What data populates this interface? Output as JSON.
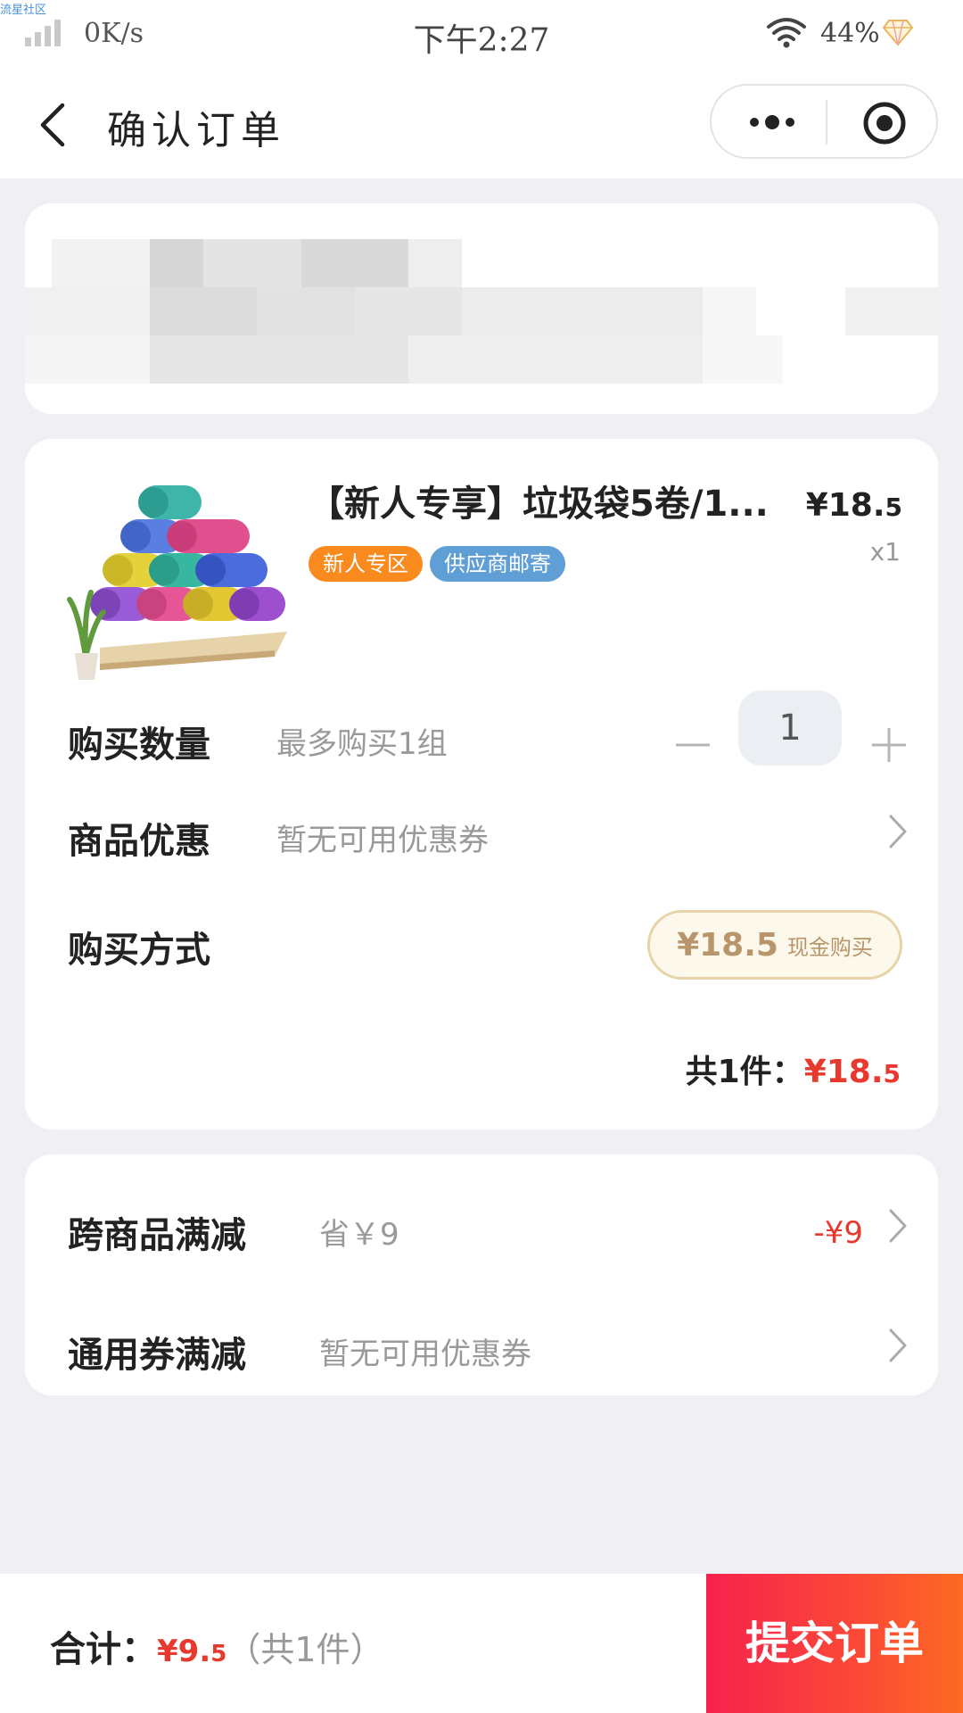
{
  "status_bar": {
    "watermark": "流星社区",
    "net_speed": "0K/s",
    "time": "下午2:27",
    "battery": "44%"
  },
  "nav": {
    "title": "确认订单",
    "icons": [
      "back-icon",
      "more-icon",
      "target-icon"
    ]
  },
  "product": {
    "title": "【新人专享】垃圾袋5卷/1...",
    "tags": [
      "新人专区",
      "供应商邮寄"
    ],
    "price_main": "¥18.",
    "price_small": "5",
    "quantity_label": "x1"
  },
  "quantity_row": {
    "label": "购买数量",
    "hint": "最多购买1组",
    "value": "1"
  },
  "coupon_row": {
    "label": "商品优惠",
    "hint": "暂无可用优惠券"
  },
  "payment_row": {
    "label": "购买方式",
    "amount": "¥18.5",
    "method": "现金购买"
  },
  "subtotal": {
    "prefix": "共1件：",
    "amount_main": "¥18.",
    "amount_small": "5"
  },
  "discounts": {
    "cross_label": "跨商品满减",
    "cross_hint": "省￥9",
    "cross_value": "-¥9",
    "general_label": "通用券满减",
    "general_hint": "暂无可用优惠券"
  },
  "footer": {
    "total_label": "合计：",
    "total_main": "¥9.",
    "total_small": "5",
    "total_count": "（共1件）",
    "submit_label": "提交订单"
  },
  "colors": {
    "accent_red": "#e8392f",
    "tag_orange": "#f88a1e",
    "tag_blue": "#5f9fd6",
    "gold": "#b8956a",
    "background": "#efeff4"
  }
}
